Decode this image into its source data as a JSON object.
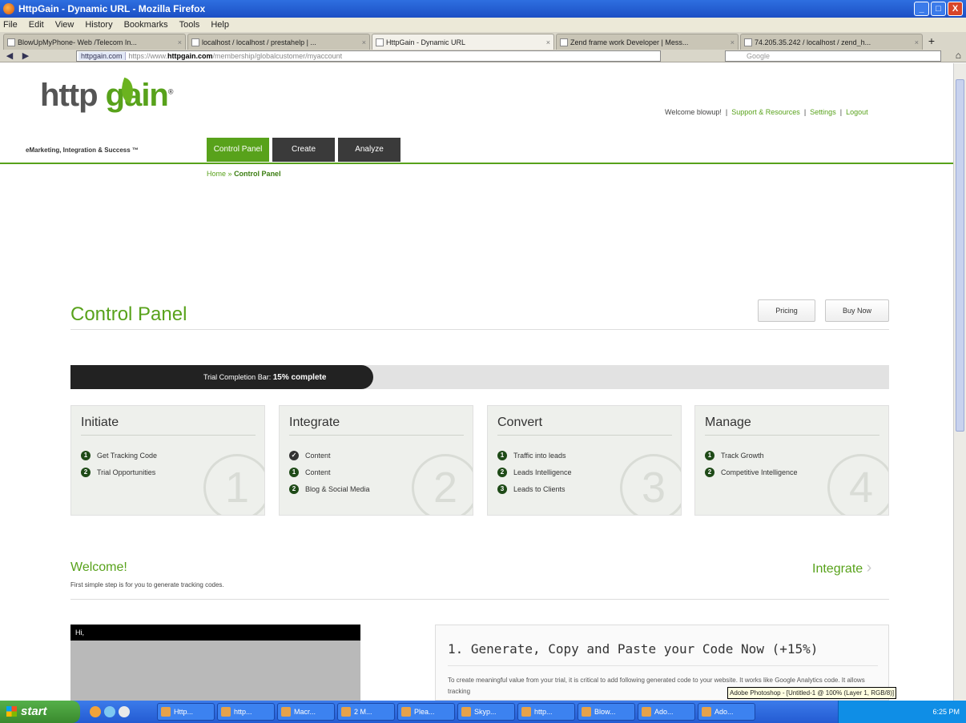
{
  "window": {
    "title": "HttpGain - Dynamic URL - Mozilla Firefox",
    "min": "_",
    "max": "□",
    "close": "X"
  },
  "menu": [
    "File",
    "Edit",
    "View",
    "History",
    "Bookmarks",
    "Tools",
    "Help"
  ],
  "tabs": [
    {
      "label": "BlowUpMyPhone- Web /Telecom In...",
      "close": "×"
    },
    {
      "label": "localhost / localhost / prestahelp | ...",
      "close": "×"
    },
    {
      "label": "HttpGain - Dynamic URL",
      "close": "×"
    },
    {
      "label": "Zend frame work Developer | Mess...",
      "close": "×"
    },
    {
      "label": "74.205.35.242 / localhost / zend_h...",
      "close": "×"
    }
  ],
  "new_tab": "+",
  "nav": {
    "back": "◀",
    "forward": "▶",
    "site": "httpgain.com",
    "url_prefix": "https://www.",
    "url_domain": "httpgain.com",
    "url_path": "/membership/globalcustomer/myaccount",
    "search_placeholder": "Google",
    "home": "⌂"
  },
  "logo": {
    "text_a": "http",
    "text_b": "gain",
    "reg": "®",
    "tagline": "eMarketing, Integration & Success ™"
  },
  "topnav": [
    "Control Panel",
    "Create",
    "Analyze"
  ],
  "toplinks": {
    "welcome": "Welcome blowup!",
    "sep": "|",
    "support": "Support & Resources",
    "settings": "Settings",
    "logout": "Logout"
  },
  "breadcrumb": {
    "home": "Home",
    "sep": "»",
    "current": "Control Panel"
  },
  "page_title": "Control Panel",
  "buttons": {
    "pricing": "Pricing",
    "buy": "Buy Now"
  },
  "trial": {
    "label": "Trial Completion Bar:",
    "value": "15% complete",
    "progress": 0.15
  },
  "steps": [
    {
      "title": "Initiate",
      "number": "1",
      "items": [
        {
          "mark": "1",
          "text": "Get Tracking Code"
        },
        {
          "mark": "2",
          "text": "Trial Opportunities"
        }
      ]
    },
    {
      "title": "Integrate",
      "number": "2",
      "items": [
        {
          "mark": "✓",
          "text": "Content"
        },
        {
          "mark": "1",
          "text": "Content"
        },
        {
          "mark": "2",
          "text": "Blog & Social Media"
        }
      ]
    },
    {
      "title": "Convert",
      "number": "3",
      "items": [
        {
          "mark": "1",
          "text": "Traffic into leads"
        },
        {
          "mark": "2",
          "text": "Leads Intelligence"
        },
        {
          "mark": "3",
          "text": "Leads to Clients"
        }
      ]
    },
    {
      "title": "Manage",
      "number": "4",
      "items": [
        {
          "mark": "1",
          "text": "Track Growth"
        },
        {
          "mark": "2",
          "text": "Competitive Intelligence"
        }
      ]
    }
  ],
  "welcome": {
    "title": "Welcome!",
    "subtitle": "First simple step is for you to generate tracking codes.",
    "next": "Integrate",
    "next_arrow": "›"
  },
  "video": {
    "header": "Hi,"
  },
  "panel": {
    "title": "1. Generate, Copy and Paste your Code Now (+15%)",
    "text": "To create meaningful value from your trial, it is critical to add following generated code to your website. It works like Google Analytics code. It allows tracking"
  },
  "tooltip": "Adobe Photoshop - [Untitled-1 @ 100% (Layer 1, RGB/8)]",
  "taskbar": {
    "start": "start",
    "tasks": [
      "Http...",
      "http...",
      "Macr...",
      "2 M...",
      "Plea...",
      "Skyp...",
      "http...",
      "Blow...",
      "Ado...",
      "Ado..."
    ],
    "clock": "6:25 PM"
  }
}
